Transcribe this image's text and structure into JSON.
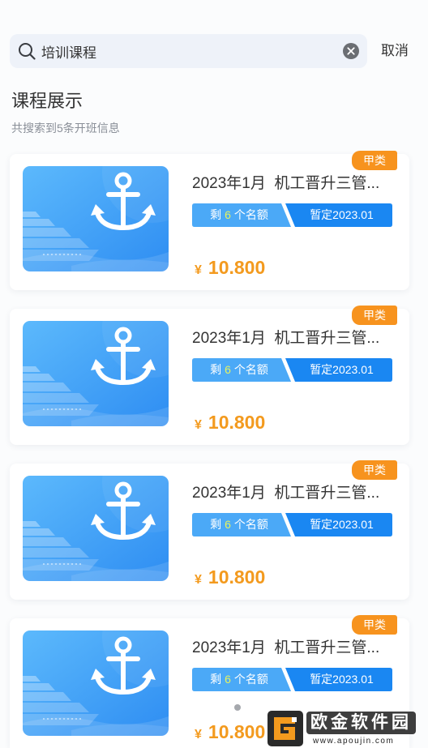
{
  "search": {
    "value": "培训课程",
    "cancel_label": "取消"
  },
  "section": {
    "title": "课程展示",
    "result_summary": "共搜索到5条开班信息"
  },
  "courses": [
    {
      "tag": "甲类",
      "title": "2023年1月  机工晋升三管...",
      "seats": {
        "prefix": "剩",
        "count": "6",
        "suffix": "个名额"
      },
      "schedule": "暂定2023.01",
      "price": {
        "currency": "¥",
        "amount": "10.800"
      }
    },
    {
      "tag": "甲类",
      "title": "2023年1月  机工晋升三管...",
      "seats": {
        "prefix": "剩",
        "count": "6",
        "suffix": "个名额"
      },
      "schedule": "暂定2023.01",
      "price": {
        "currency": "¥",
        "amount": "10.800"
      }
    },
    {
      "tag": "甲类",
      "title": "2023年1月  机工晋升三管...",
      "seats": {
        "prefix": "剩",
        "count": "6",
        "suffix": "个名额"
      },
      "schedule": "暂定2023.01",
      "price": {
        "currency": "¥",
        "amount": "10.800"
      }
    },
    {
      "tag": "甲类",
      "title": "2023年1月  机工晋升三管...",
      "seats": {
        "prefix": "剩",
        "count": "6",
        "suffix": "个名额"
      },
      "schedule": "暂定2023.01",
      "price": {
        "currency": "¥",
        "amount": "10.800"
      }
    }
  ],
  "watermark": {
    "name": "欧金软件园",
    "url": "www.apoujin.com"
  },
  "icons": {
    "search": "search-icon",
    "clear": "clear-icon",
    "thumbnail": "anchor-icon",
    "watermark_logo": "logo-icon"
  },
  "colors": {
    "tag": "#f7931e",
    "price": "#f39a1e",
    "badge_light": "#4ba9f7",
    "badge_dark": "#1a87f2",
    "seat_count": "#e8f35c",
    "search_bg": "#eef2f9",
    "thumbnail_light": "#5cb9fc",
    "thumbnail_dark": "#2e8df2"
  }
}
